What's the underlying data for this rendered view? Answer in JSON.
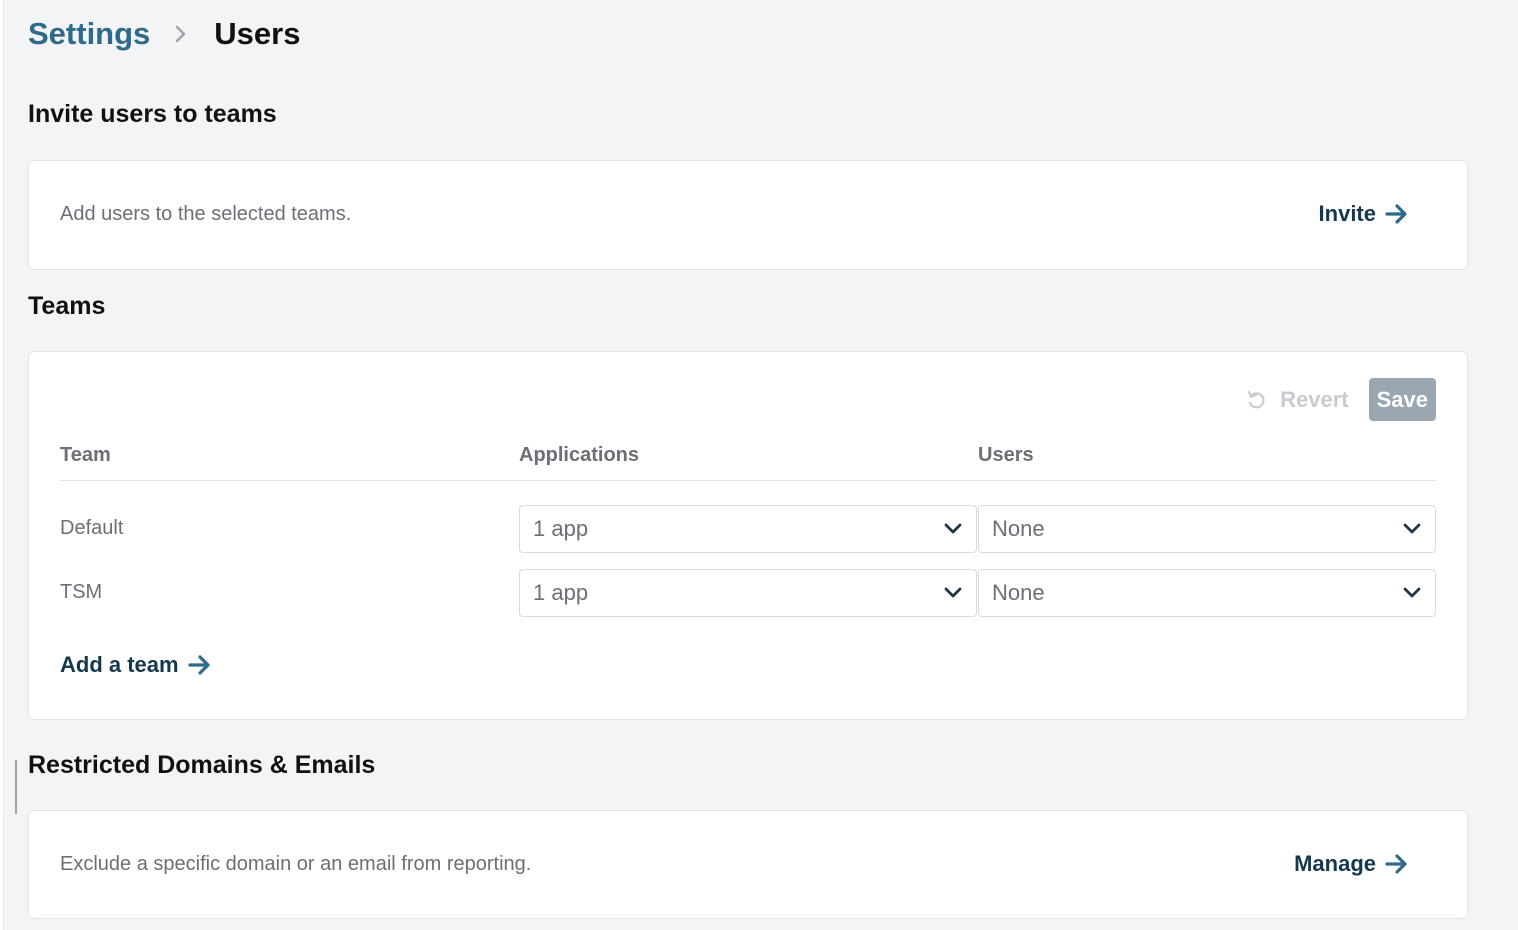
{
  "breadcrumb": {
    "parent": "Settings",
    "current": "Users"
  },
  "invite": {
    "title": "Invite users to teams",
    "description": "Add users to the selected teams.",
    "action": "Invite"
  },
  "teams": {
    "title": "Teams",
    "revert_label": "Revert",
    "save_label": "Save",
    "columns": [
      "Team",
      "Applications",
      "Users"
    ],
    "rows": [
      {
        "team": "Default",
        "applications": "1 app",
        "users": "None"
      },
      {
        "team": "TSM",
        "applications": "1 app",
        "users": "None"
      }
    ],
    "add_team_label": "Add a team"
  },
  "restricted": {
    "title": "Restricted Domains & Emails",
    "description": "Exclude a specific domain or an email from reporting.",
    "action": "Manage"
  },
  "colors": {
    "link": "#2e6b8a",
    "action": "#14384d",
    "save_disabled": "#9aa6b0",
    "page_bg": "#f3f4f6"
  },
  "icons": {
    "breadcrumb_separator": "chevron-right-icon",
    "action_arrow": "arrow-right-icon",
    "revert": "undo-icon",
    "dropdown": "chevron-down-icon"
  }
}
